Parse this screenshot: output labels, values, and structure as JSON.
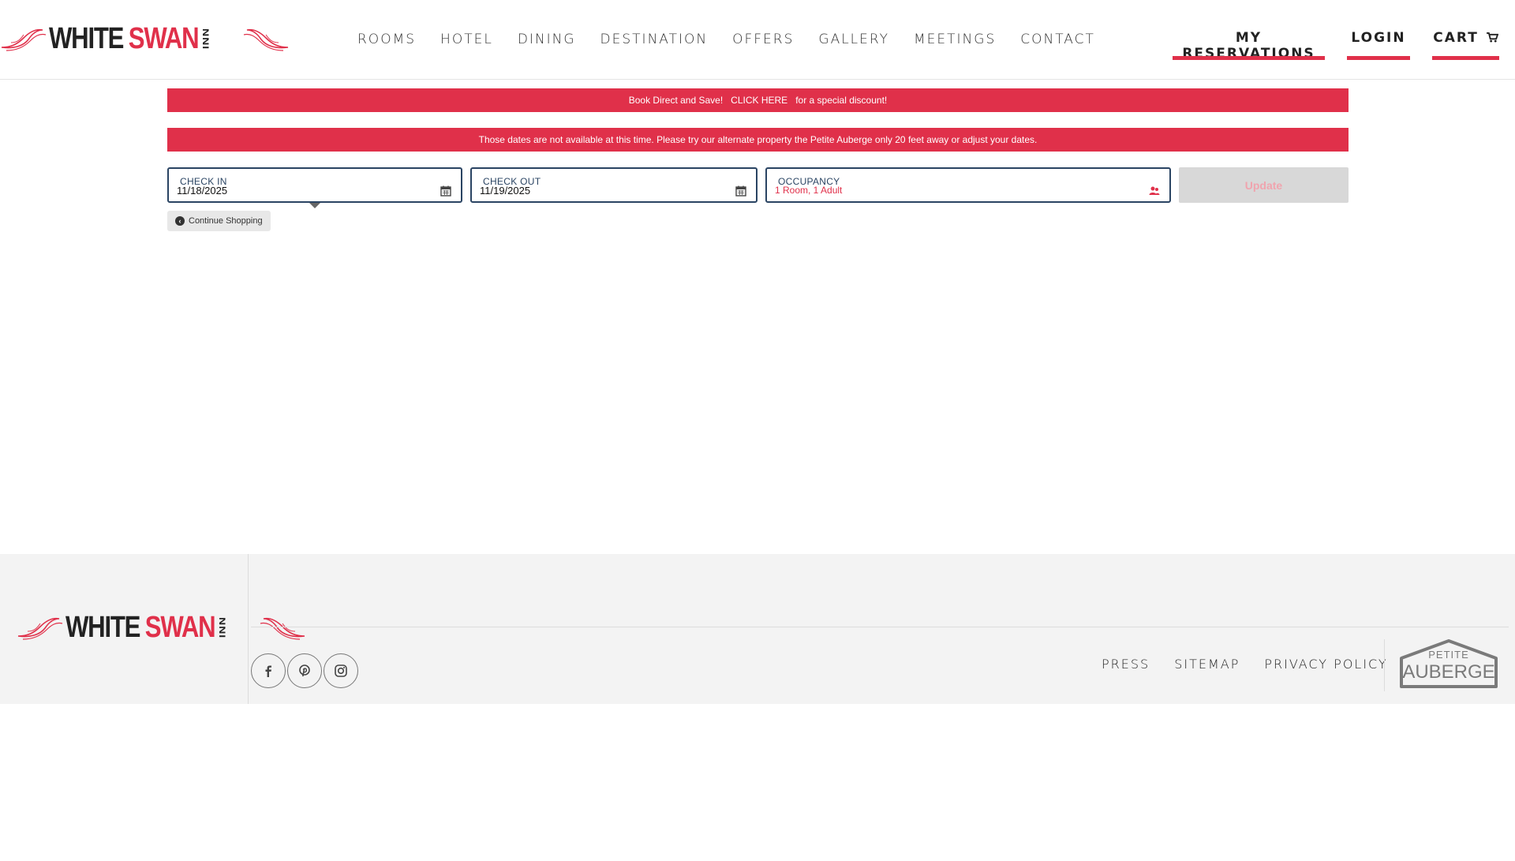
{
  "brand": {
    "logo_primary": "WHITE",
    "logo_accent": "SWAN",
    "logo_suffix": "INN",
    "accent_color": "#e0304a",
    "navy_color": "#2a4463"
  },
  "nav": {
    "items": [
      {
        "label": "ROOMS"
      },
      {
        "label": "HOTEL"
      },
      {
        "label": "DINING"
      },
      {
        "label": "DESTINATION"
      },
      {
        "label": "OFFERS"
      },
      {
        "label": "GALLERY"
      },
      {
        "label": "MEETINGS"
      },
      {
        "label": "CONTACT"
      }
    ]
  },
  "account": {
    "reservations_label": "MY RESERVATIONS",
    "login_label": "LOGIN",
    "cart_label": "CART"
  },
  "banners": {
    "promo_prefix": "Book Direct and Save!",
    "promo_link": "CLICK HERE",
    "promo_suffix": "for a special discount!",
    "availability_message": "Those dates are not available at this time. Please try our alternate property the Petite Auberge only 20 feet away or adjust your dates."
  },
  "booking": {
    "check_in_label": "CHECK IN",
    "check_in_value": "11/18/2025",
    "check_out_label": "CHECK OUT",
    "check_out_value": "11/19/2025",
    "occupancy_label": "OCCUPANCY",
    "occupancy_value": "1 Room, 1 Adult",
    "update_label": "Update",
    "continue_label": "Continue Shopping"
  },
  "footer": {
    "links": [
      {
        "label": "PRESS"
      },
      {
        "label": "SITEMAP"
      },
      {
        "label": "PRIVACY POLICY"
      }
    ],
    "partner_small": "PETITE",
    "partner_large": "AUBERGE",
    "social_icons": [
      "facebook-icon",
      "pinterest-icon",
      "instagram-icon"
    ]
  }
}
